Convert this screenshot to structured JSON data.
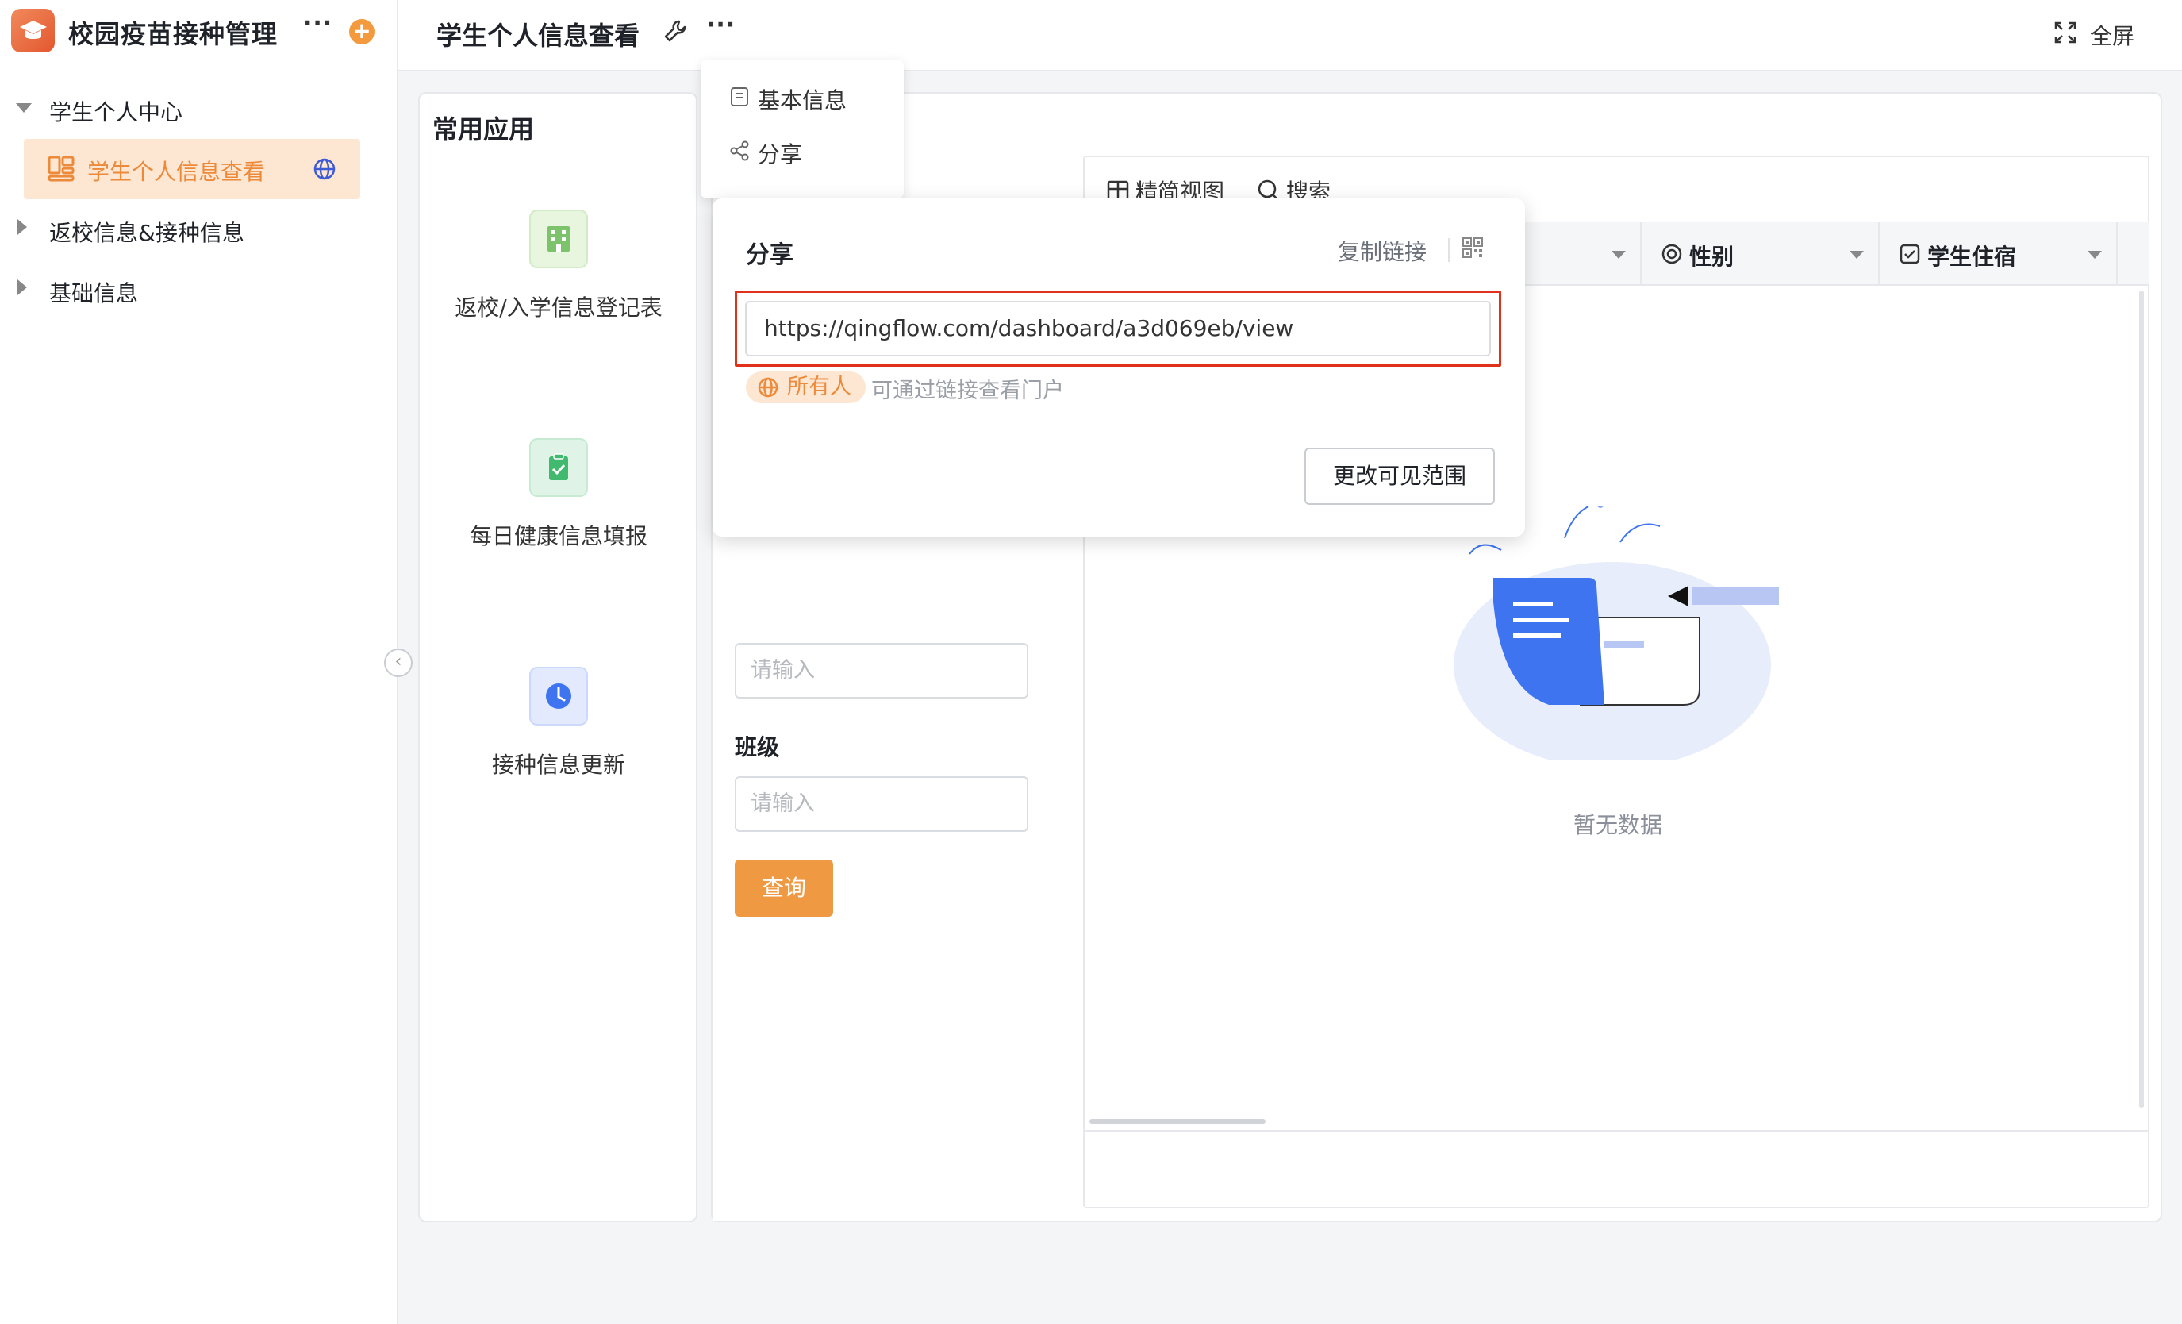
{
  "sidebar": {
    "app_title": "校园疫苗接种管理",
    "more_dots": "···",
    "add_label": "+",
    "tree": [
      {
        "label": "学生个人中心"
      },
      {
        "label": "学生个人信息查看"
      },
      {
        "label": "返校信息&接种信息"
      },
      {
        "label": "基础信息"
      }
    ],
    "collapse_glyph": "‹"
  },
  "header": {
    "page_title": "学生个人信息查看",
    "more_dots": "···",
    "fullscreen_label": "全屏"
  },
  "common_apps": {
    "title": "常用应用",
    "items": [
      {
        "label": "返校/入学信息登记表",
        "icon": "building-icon",
        "color": "#7cc36b"
      },
      {
        "label": "每日健康信息填报",
        "icon": "clipboard-check-icon",
        "color": "#41b96f"
      },
      {
        "label": "接种信息更新",
        "icon": "clock-icon",
        "color": "#3e74f0"
      }
    ]
  },
  "filter": {
    "input1_placeholder": "请输入",
    "class_label": "班级",
    "input2_placeholder": "请输入",
    "query_label": "查询"
  },
  "table": {
    "toolbar": {
      "simple_view": "精简视图",
      "search": "搜索"
    },
    "columns": [
      {
        "label": "性别",
        "icon": "radio-icon"
      },
      {
        "label": "学生住宿",
        "icon": "checkbox-icon"
      }
    ],
    "empty_text": "暂无数据"
  },
  "menu": {
    "items": [
      {
        "label": "基本信息",
        "icon": "document-icon"
      },
      {
        "label": "分享",
        "icon": "share-icon"
      }
    ]
  },
  "share": {
    "title": "分享",
    "copy_link": "复制链接",
    "url": "https://qingflow.com/dashboard/a3d069eb/view",
    "badge": "所有人",
    "badge_desc": "可通过链接查看门户",
    "scope_button": "更改可见范围",
    "highlight_color": "#e0321b"
  },
  "colors": {
    "accent": "#ef9a42",
    "active_bg": "#fde6d2"
  }
}
